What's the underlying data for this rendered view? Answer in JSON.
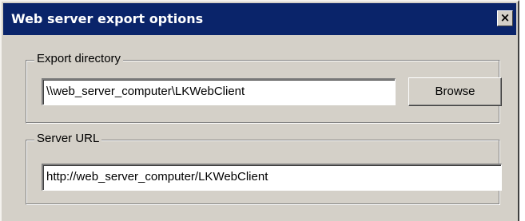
{
  "window": {
    "title": "Web server export options",
    "close_glyph": "×"
  },
  "export_directory": {
    "legend": "Export directory",
    "value": "\\\\web_server_computer\\LKWebClient",
    "browse_label": "Browse"
  },
  "server_url": {
    "legend": "Server URL",
    "value": "http://web_server_computer/LKWebClient"
  },
  "colors": {
    "titlebar": "#0a246a",
    "dialog_face": "#d4d0c8",
    "field_background": "#ffffff"
  }
}
